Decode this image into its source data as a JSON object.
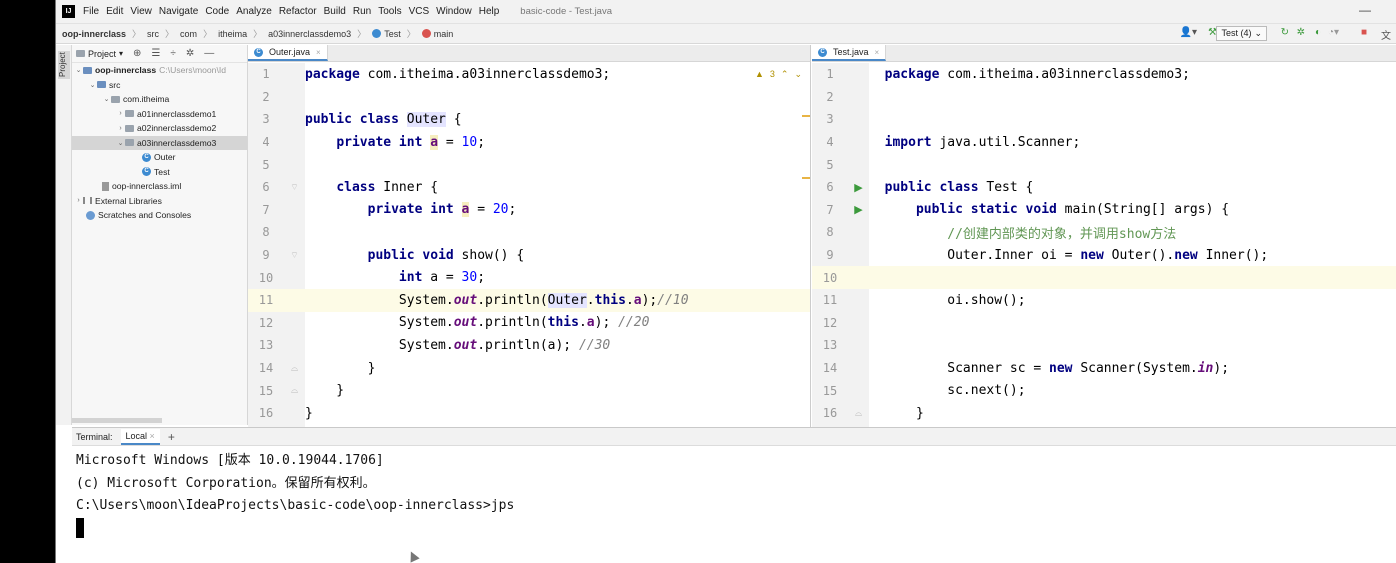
{
  "menubar": {
    "items": [
      "File",
      "Edit",
      "View",
      "Navigate",
      "Code",
      "Analyze",
      "Refactor",
      "Build",
      "Run",
      "Tools",
      "VCS",
      "Window",
      "Help"
    ],
    "window_title": "basic-code - Test.java"
  },
  "navbar": {
    "breadcrumbs": [
      "oop-innerclass",
      "src",
      "com",
      "itheima",
      "a03innerclassdemo3",
      "Test",
      "main"
    ],
    "run_config": "Test (4)"
  },
  "left_stripe": {
    "label": "Project"
  },
  "project_panel": {
    "header": "Project",
    "tree": [
      {
        "label": "oop-innerclass",
        "hint": "C:\\Users\\moon\\Id",
        "icon": "folder-icon",
        "bold": true
      },
      {
        "label": "src",
        "icon": "folder-icon"
      },
      {
        "label": "com.itheima",
        "icon": "package-icon"
      },
      {
        "label": "a01innerclassdemo1",
        "icon": "package-icon"
      },
      {
        "label": "a02innerclassdemo2",
        "icon": "package-icon"
      },
      {
        "label": "a03innerclassdemo3",
        "icon": "package-icon",
        "selected": true
      },
      {
        "label": "Outer",
        "icon": "class-icon"
      },
      {
        "label": "Test",
        "icon": "class-icon"
      },
      {
        "label": "oop-innerclass.iml",
        "icon": "file-icon"
      },
      {
        "label": "External Libraries",
        "icon": "library-icon"
      },
      {
        "label": "Scratches and Consoles",
        "icon": "scratches-icon"
      }
    ]
  },
  "editor_left": {
    "tab": "Outer.java",
    "warning_count": "3",
    "line_numbers": [
      "1",
      "2",
      "3",
      "4",
      "5",
      "6",
      "7",
      "8",
      "9",
      "10",
      "11",
      "12",
      "13",
      "14",
      "15",
      "16"
    ]
  },
  "editor_right": {
    "tab": "Test.java",
    "line_numbers": [
      "1",
      "2",
      "3",
      "4",
      "5",
      "6",
      "7",
      "8",
      "9",
      "10",
      "11",
      "12",
      "13",
      "14",
      "15",
      "16"
    ]
  },
  "terminal": {
    "tab_label": "Terminal:",
    "local_tab": "Local",
    "lines": [
      "Microsoft Windows [版本 10.0.19044.1706]",
      "(c) Microsoft Corporation。保留所有权利。",
      "",
      "C:\\Users\\moon\\IdeaProjects\\basic-code\\oop-innerclass>jps"
    ]
  },
  "colors": {
    "keyword": "#000080",
    "number": "#0000ff",
    "field": "#660e7a",
    "comment": "#808080",
    "accent": "#4a88c7"
  }
}
